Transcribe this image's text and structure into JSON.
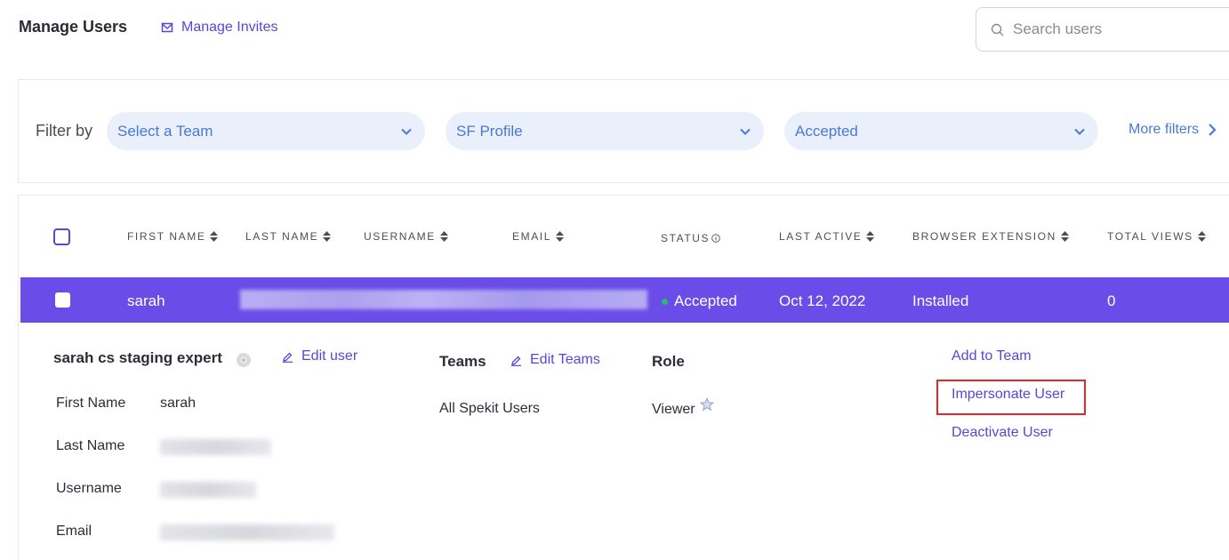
{
  "header": {
    "title": "Manage Users",
    "manage_invites": "Manage Invites",
    "search_placeholder": "Search users"
  },
  "filters": {
    "label": "Filter by",
    "team": "Select a Team",
    "profile": "SF Profile",
    "status": "Accepted",
    "more": "More filters"
  },
  "table": {
    "columns": {
      "first_name": "FIRST NAME",
      "last_name": "LAST NAME",
      "username": "USERNAME",
      "email": "EMAIL",
      "status": "STATUS",
      "last_active": "LAST ACTIVE",
      "browser_extension": "BROWSER EXTENSION",
      "total_views": "TOTAL VIEWS"
    },
    "row": {
      "first_name": "sarah",
      "status": "Accepted",
      "last_active": "Oct 12, 2022",
      "browser_extension": "Installed",
      "total_views": "0"
    }
  },
  "detail": {
    "full_name": "sarah cs staging expert",
    "edit_user": "Edit user",
    "teams_heading": "Teams",
    "edit_teams": "Edit Teams",
    "team_value": "All Spekit Users",
    "role_heading": "Role",
    "role_value": "Viewer",
    "fields": {
      "first_name_label": "First Name",
      "first_name_value": "sarah",
      "last_name_label": "Last Name",
      "username_label": "Username",
      "email_label": "Email"
    },
    "actions": {
      "add_to_team": "Add to Team",
      "impersonate": "Impersonate User",
      "deactivate": "Deactivate User"
    }
  },
  "colors": {
    "accent": "#5a45d8",
    "row_selected": "#6a4ce9",
    "filter_bg": "#eaf0fb",
    "filter_text": "#4a78d6",
    "status_green": "#2bb673",
    "highlight_red": "#e02a2a"
  }
}
